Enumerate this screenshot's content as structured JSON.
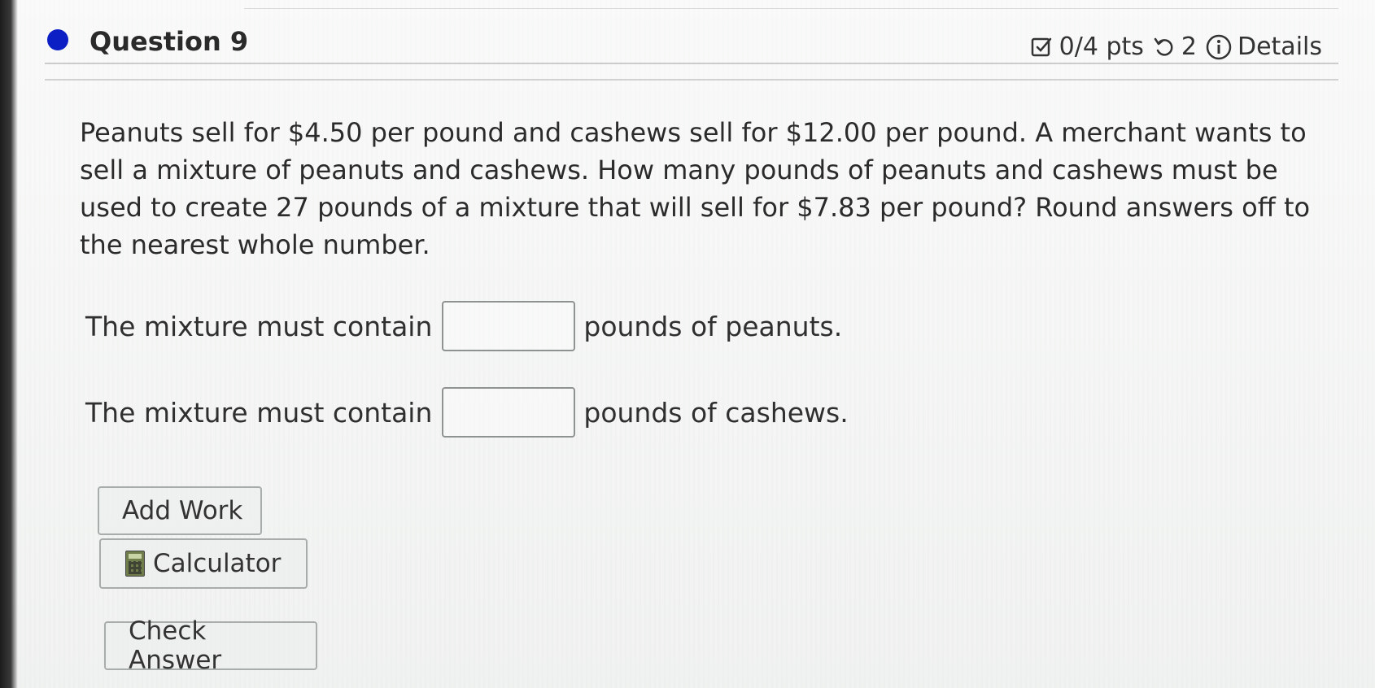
{
  "header": {
    "title": "Question 9",
    "points": "0/4 pts",
    "attempts": "2",
    "details_label": "Details"
  },
  "question": {
    "text": "Peanuts sell for $4.50 per pound and cashews sell for $12.00 per pound.  A merchant wants to sell a mixture of peanuts and cashews.  How many pounds of peanuts and cashews must be used to create 27 pounds of a mixture that will sell for $7.83 per pound?  Round answers off to the nearest whole number."
  },
  "answers": [
    {
      "prefix": "The mixture must contain",
      "value": "",
      "suffix": "pounds of peanuts."
    },
    {
      "prefix": "The mixture must contain",
      "value": "",
      "suffix": "pounds of cashews."
    }
  ],
  "buttons": {
    "add_work": "Add Work",
    "calculator": "Calculator",
    "check_answer": "Check Answer"
  },
  "colors": {
    "question_dot": "#0b1fc4"
  },
  "icons": {
    "points": "checkbox-edit-icon",
    "attempts": "retry-icon",
    "details": "info-icon",
    "calculator": "calculator-icon"
  }
}
